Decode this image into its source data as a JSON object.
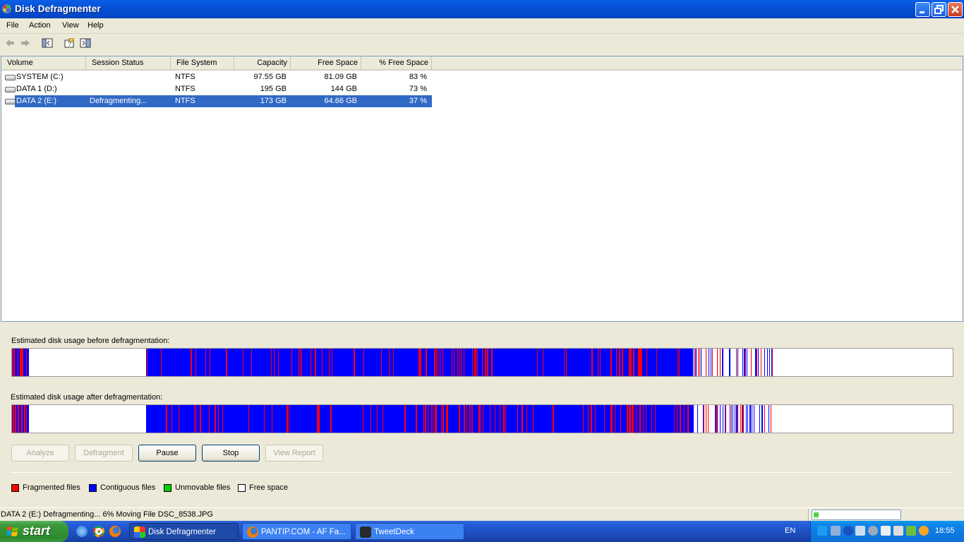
{
  "window": {
    "title": "Disk Defragmenter",
    "controls": [
      "minimize",
      "restore",
      "close"
    ]
  },
  "menu": [
    "File",
    "Action",
    "View",
    "Help"
  ],
  "toolbar_icons": [
    "back-icon",
    "forward-icon",
    "show-hide-tree-icon",
    "help-icon",
    "properties-icon"
  ],
  "volumes": {
    "columns": [
      "Volume",
      "Session Status",
      "File System",
      "Capacity",
      "Free Space",
      "% Free Space"
    ],
    "rows": [
      {
        "volume": "SYSTEM (C:)",
        "status": "",
        "fs": "NTFS",
        "capacity": "97.55 GB",
        "free": "81.09 GB",
        "pct": "83 %",
        "selected": false
      },
      {
        "volume": "DATA 1 (D:)",
        "status": "",
        "fs": "NTFS",
        "capacity": "195 GB",
        "free": "144 GB",
        "pct": "73 %",
        "selected": false
      },
      {
        "volume": "DATA 2 (E:)",
        "status": "Defragmenting...",
        "fs": "NTFS",
        "capacity": "173 GB",
        "free": "64.66 GB",
        "pct": "37 %",
        "selected": true
      }
    ]
  },
  "analysis": {
    "before_label": "Estimated disk usage before defragmentation:",
    "after_label": "Estimated disk usage after defragmentation:"
  },
  "buttons": {
    "analyze": "Analyze",
    "defragment": "Defragment",
    "pause": "Pause",
    "stop": "Stop",
    "view_report": "View Report"
  },
  "legend": [
    {
      "label": "Fragmented files",
      "color": "#ff0000"
    },
    {
      "label": "Contiguous files",
      "color": "#0000ff"
    },
    {
      "label": "Unmovable files",
      "color": "#00cc00"
    },
    {
      "label": "Free space",
      "color": "#ffffff"
    }
  ],
  "statusbar": {
    "text": "DATA 2 (E:) Defragmenting... 6%  Moving File DSC_8538.JPG",
    "progress_percent": 6
  },
  "taskbar": {
    "start_label": "start",
    "quick_launch": [
      "ie-icon",
      "chrome-icon",
      "firefox-icon"
    ],
    "tasks": [
      {
        "label": "Disk Defragmenter",
        "active": true
      },
      {
        "label": "PANTIP.COM - AF Fa...",
        "active": false
      },
      {
        "label": "TweetDeck",
        "active": false
      }
    ],
    "language": "EN",
    "clock": "18:55"
  },
  "colors": {
    "fragmented": "#ff0000",
    "contiguous": "#0000ff",
    "free": "#ffffff",
    "selection": "#316ac5",
    "titlebar": "#0651d6"
  }
}
